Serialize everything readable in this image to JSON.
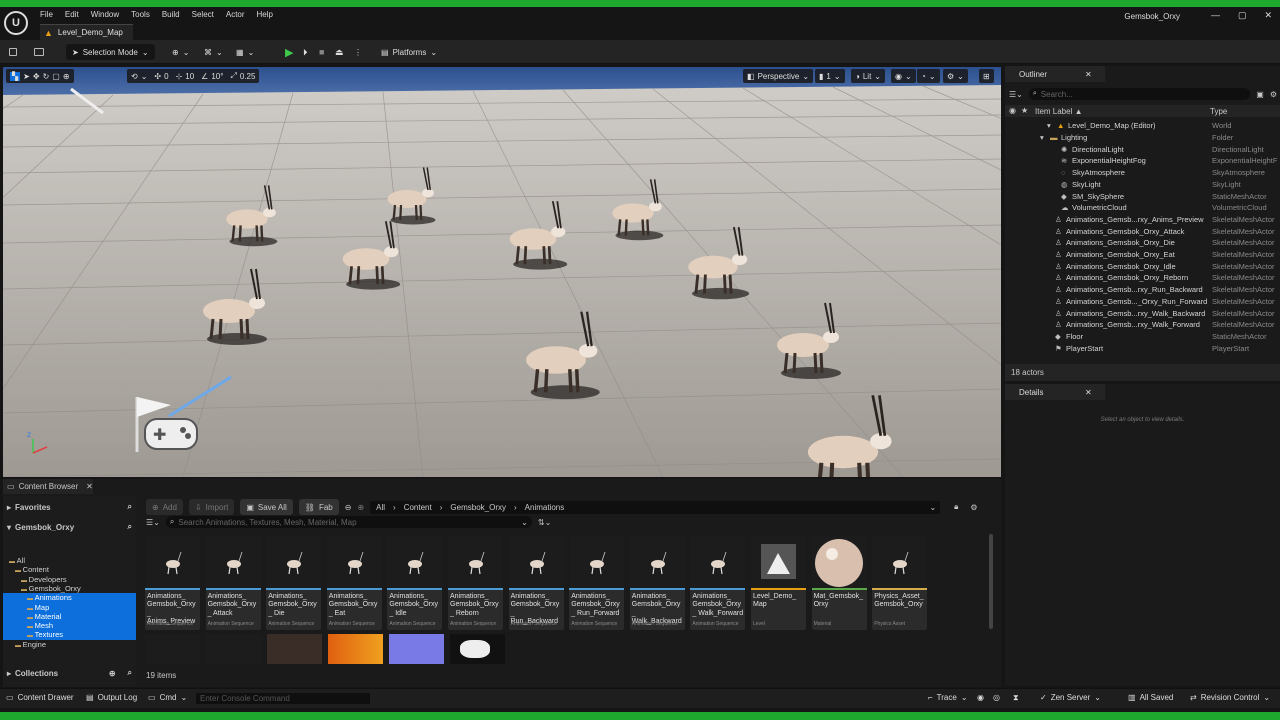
{
  "app": {
    "logo": "U",
    "project": "Gemsbok_Orxy",
    "map_tab": "Level_Demo_Map"
  },
  "window_controls": {
    "minimize": "—",
    "maximize": "▢",
    "close": "✕"
  },
  "menu": [
    "File",
    "Edit",
    "Window",
    "Tools",
    "Build",
    "Select",
    "Actor",
    "Help"
  ],
  "toolbar": {
    "selection_mode": "Selection Mode",
    "platforms": "Platforms"
  },
  "viewport_toolbar": {
    "snap_rotation": "0",
    "grid_size": "10",
    "rotation_snap": "10°",
    "scale_snap": "0.25",
    "view_mode": "Perspective",
    "camera_speed": "1",
    "lit": "Lit"
  },
  "outliner": {
    "title": "Outliner",
    "search_placeholder": "Search...",
    "col_label": "Item Label ▲",
    "col_type": "Type",
    "rows": [
      {
        "name": "Level_Demo_Map (Editor)",
        "type": "World",
        "icon": "map-icon"
      },
      {
        "name": "Lighting",
        "type": "Folder",
        "icon": "folder-icon"
      },
      {
        "name": "DirectionalLight",
        "type": "DirectionalLight",
        "icon": "light-icon"
      },
      {
        "name": "ExponentialHeightFog",
        "type": "ExponentialHeightF",
        "icon": "fog-icon"
      },
      {
        "name": "SkyAtmosphere",
        "type": "SkyAtmosphere",
        "icon": "sky-icon"
      },
      {
        "name": "SkyLight",
        "type": "SkyLight",
        "icon": "skylight-icon"
      },
      {
        "name": "SM_SkySphere",
        "type": "StaticMeshActor",
        "icon": "mesh-icon"
      },
      {
        "name": "VolumetricCloud",
        "type": "VolumetricCloud",
        "icon": "cloud-icon"
      },
      {
        "name": "Animations_Gemsb...rxy_Anims_Preview",
        "type": "SkeletalMeshActor",
        "icon": "skeletal-icon"
      },
      {
        "name": "Animations_Gemsbok_Orxy_Attack",
        "type": "SkeletalMeshActor",
        "icon": "skeletal-icon"
      },
      {
        "name": "Animations_Gemsbok_Orxy_Die",
        "type": "SkeletalMeshActor",
        "icon": "skeletal-icon"
      },
      {
        "name": "Animations_Gemsbok_Orxy_Eat",
        "type": "SkeletalMeshActor",
        "icon": "skeletal-icon"
      },
      {
        "name": "Animations_Gemsbok_Orxy_Idle",
        "type": "SkeletalMeshActor",
        "icon": "skeletal-icon"
      },
      {
        "name": "Animations_Gemsbok_Orxy_Reborn",
        "type": "SkeletalMeshActor",
        "icon": "skeletal-icon"
      },
      {
        "name": "Animations_Gemsb...rxy_Run_Backward",
        "type": "SkeletalMeshActor",
        "icon": "skeletal-icon"
      },
      {
        "name": "Animations_Gemsb..._Orxy_Run_Forward",
        "type": "SkeletalMeshActor",
        "icon": "skeletal-icon"
      },
      {
        "name": "Animations_Gemsb...rxy_Walk_Backward",
        "type": "SkeletalMeshActor",
        "icon": "skeletal-icon"
      },
      {
        "name": "Animations_Gemsb...rxy_Walk_Forward",
        "type": "SkeletalMeshActor",
        "icon": "skeletal-icon"
      },
      {
        "name": "Floor",
        "type": "StaticMeshActor",
        "icon": "mesh-icon"
      },
      {
        "name": "PlayerStart",
        "type": "PlayerStart",
        "icon": "player-icon"
      }
    ],
    "actor_count": "18 actors"
  },
  "details": {
    "title": "Details",
    "empty_text": "Select an object to view details."
  },
  "content_browser": {
    "tab": "Content Browser",
    "favorites": "Favorites",
    "project_root": "Gemsbok_Orxy",
    "collections": "Collections",
    "tree": [
      {
        "label": "All",
        "level": 0,
        "selected": false
      },
      {
        "label": "Content",
        "level": 1,
        "selected": false
      },
      {
        "label": "Developers",
        "level": 2,
        "selected": false
      },
      {
        "label": "Gemsbok_Orxy",
        "level": 2,
        "selected": false
      },
      {
        "label": "Animations",
        "level": 3,
        "selected": true
      },
      {
        "label": "Map",
        "level": 3,
        "selected": true
      },
      {
        "label": "Material",
        "level": 3,
        "selected": true
      },
      {
        "label": "Mesh",
        "level": 3,
        "selected": true
      },
      {
        "label": "Textures",
        "level": 3,
        "selected": true
      },
      {
        "label": "Engine",
        "level": 1,
        "selected": false
      }
    ],
    "buttons": {
      "add": "Add",
      "import": "Import",
      "save_all": "Save All",
      "fab": "Fab"
    },
    "breadcrumb": [
      "All",
      "Content",
      "Gemsbok_Orxy",
      "Animations"
    ],
    "search_placeholder": "Search Animations, Textures, Mesh, Material, Map",
    "item_count": "19 items",
    "assets": [
      {
        "name": "Animations_ Gemsbok_Orxy_ Anims_Preview",
        "type": "Animation Sequence",
        "kind": "anim",
        "color": "#4a9bd6"
      },
      {
        "name": "Animations_ Gemsbok_Orxy_ Attack",
        "type": "Animation Sequence",
        "kind": "anim",
        "color": "#4a9bd6"
      },
      {
        "name": "Animations_ Gemsbok_Orxy_ Die",
        "type": "Animation Sequence",
        "kind": "anim",
        "color": "#4a9bd6"
      },
      {
        "name": "Animations_ Gemsbok_Orxy_ Eat",
        "type": "Animation Sequence",
        "kind": "anim",
        "color": "#4a9bd6"
      },
      {
        "name": "Animations_ Gemsbok_Orxy_ Idle",
        "type": "Animation Sequence",
        "kind": "anim",
        "color": "#4a9bd6"
      },
      {
        "name": "Animations_ Gemsbok_Orxy_ Reborn",
        "type": "Animation Sequence",
        "kind": "anim",
        "color": "#4a9bd6"
      },
      {
        "name": "Animations_ Gemsbok_Orxy_ Run_Backward",
        "type": "Animation Sequence",
        "kind": "anim",
        "color": "#4a9bd6"
      },
      {
        "name": "Animations_ Gemsbok_Orxy_ Run_Forward",
        "type": "Animation Sequence",
        "kind": "anim",
        "color": "#4a9bd6"
      },
      {
        "name": "Animations_ Gemsbok_Orxy_ Walk_Backward",
        "type": "Animation Sequence",
        "kind": "anim",
        "color": "#4a9bd6"
      },
      {
        "name": "Animations_ Gemsbok_Orxy_ Walk_Forward",
        "type": "Animation Sequence",
        "kind": "anim",
        "color": "#4a9bd6"
      },
      {
        "name": "Level_Demo_ Map",
        "type": "Level",
        "kind": "level",
        "color": "#e8a013"
      },
      {
        "name": "Mat_Gemsbok_ Orxy",
        "type": "Material",
        "kind": "material",
        "color": "#5aa84a"
      },
      {
        "name": "Physics_Asset_ Gemsbok_Orxy",
        "type": "Physics Asset",
        "kind": "anim",
        "color": "#d6ad4a"
      }
    ]
  },
  "statusbar": {
    "content_drawer": "Content Drawer",
    "output_log": "Output Log",
    "cmd": "Cmd",
    "console_placeholder": "Enter Console Command",
    "trace": "Trace",
    "zen_server": "Zen Server",
    "all_saved": "All Saved",
    "revision_control": "Revision Control"
  },
  "colors": {
    "accent_green": "#1fa82e",
    "selection_blue": "#0c6fdc",
    "play_green": "#3ec94c"
  }
}
